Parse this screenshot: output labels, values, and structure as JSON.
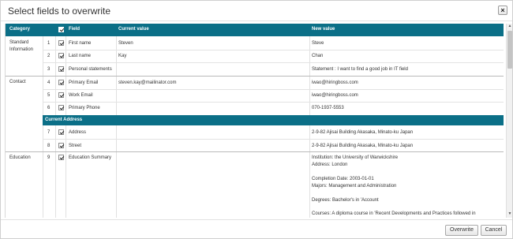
{
  "dialog": {
    "title": "Select fields to overwrite",
    "close_glyph": "×"
  },
  "table": {
    "headers": {
      "category": "Category",
      "field": "Field",
      "current": "Current value",
      "new": "New value"
    },
    "categories": {
      "standard": "Standard Information",
      "contact": "Contact",
      "education": "Education"
    },
    "subsection": "Current Address",
    "rows": [
      {
        "num": "1",
        "field": "First name",
        "current": "Steven",
        "new": "Steve"
      },
      {
        "num": "2",
        "field": "Last name",
        "current": "Kay",
        "new": "Chan"
      },
      {
        "num": "3",
        "field": "Personal statements",
        "current": "",
        "new": "Statement : I want to find a good job in IT field"
      },
      {
        "num": "4",
        "field": "Primary Email",
        "current": "steven.kay@mailinator.com",
        "new": "iwao@hiringboss.com"
      },
      {
        "num": "5",
        "field": "Work Email",
        "current": "",
        "new": "iwao@hiringboss.com"
      },
      {
        "num": "6",
        "field": "Primary Phone",
        "current": "",
        "new": "070-1937-5553"
      },
      {
        "num": "7",
        "field": "Address",
        "current": "",
        "new": "2-9-82 Ajisai Building Akasaka, Minato-ku Japan"
      },
      {
        "num": "8",
        "field": "Street",
        "current": "",
        "new": "2-9-82 Ajisai Building Akasaka, Minato-ku Japan"
      },
      {
        "num": "9",
        "field": "Education Summary",
        "current": "",
        "new": ""
      }
    ],
    "education_new_lines": [
      "Institution: the University of Warwickshire",
      "Address: London",
      "Completion Date: 2003-01-01",
      "Majors: Management and Administration",
      "Degrees: Bachelor's in 'Account",
      "Courses: A diploma course in 'Recent Developments and Practices followed in"
    ]
  },
  "footer": {
    "overwrite_label": "Overwrite",
    "cancel_label": "Cancel"
  },
  "colors": {
    "header_bg": "#0b6f87"
  },
  "icons": {
    "close": "close-icon",
    "checkbox": "checkbox-checked-icon"
  }
}
